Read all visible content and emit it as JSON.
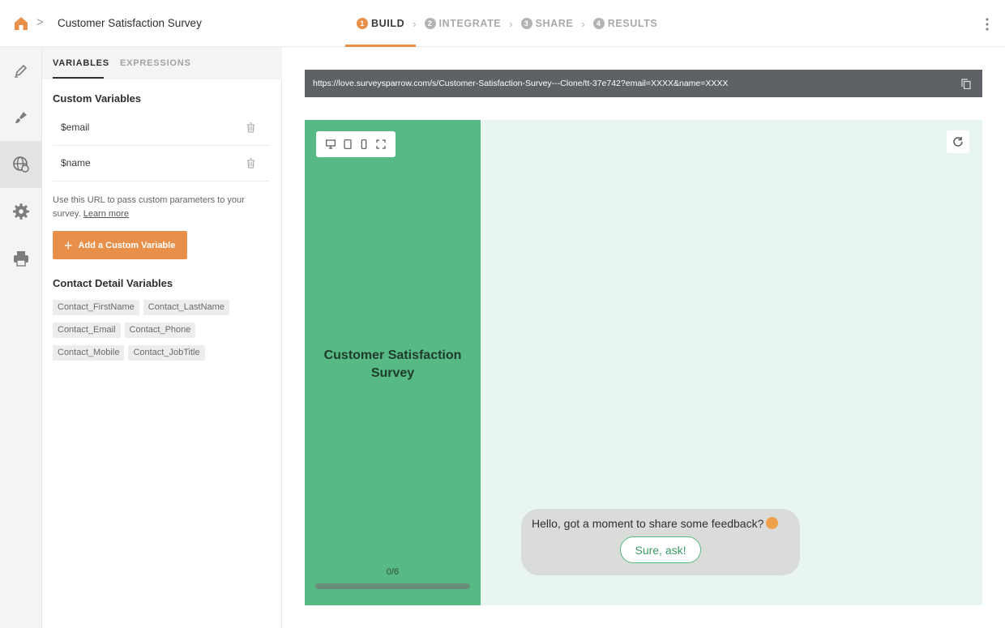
{
  "topbar": {
    "title": "Customer Satisfaction Survey",
    "breadcrumb_separator": ">",
    "steps": [
      {
        "num": "1",
        "label": "BUILD",
        "active": true
      },
      {
        "num": "2",
        "label": "INTEGRATE",
        "active": false
      },
      {
        "num": "3",
        "label": "SHARE",
        "active": false
      },
      {
        "num": "4",
        "label": "RESULTS",
        "active": false
      }
    ],
    "accent_color": "#e8904a"
  },
  "rail": {
    "items": [
      {
        "icon": "pencil-icon",
        "active": false
      },
      {
        "icon": "brush-icon",
        "active": false
      },
      {
        "icon": "globe-icon",
        "active": true
      },
      {
        "icon": "gear-icon",
        "active": false
      },
      {
        "icon": "printer-icon",
        "active": false
      }
    ]
  },
  "panel": {
    "tabs": [
      "VARIABLES",
      "EXPRESSIONS"
    ],
    "custom_variables_title": "Custom Variables",
    "custom_variables": [
      "$email",
      "$name"
    ],
    "help_text": "Use this URL to pass custom parameters to your survey.",
    "learn_more": "Learn more",
    "add_button": "Add a Custom Variable",
    "contact_title": "Contact Detail Variables",
    "contact_variables": [
      "Contact_FirstName",
      "Contact_LastName",
      "Contact_Email",
      "Contact_Phone",
      "Contact_Mobile",
      "Contact_JobTitle"
    ]
  },
  "preview": {
    "url": "https://love.surveysparrow.com/s/Customer-Satisfaction-Survey---Clone/tt-37e742?email=XXXX&name=XXXX",
    "survey_title": "Customer Satisfaction Survey",
    "progress": "0/6",
    "progress_fraction": 0,
    "chat_message": "Hello, got a moment to share some feedback?",
    "chat_button": "Sure, ask!",
    "theme_color": "#57b983"
  }
}
